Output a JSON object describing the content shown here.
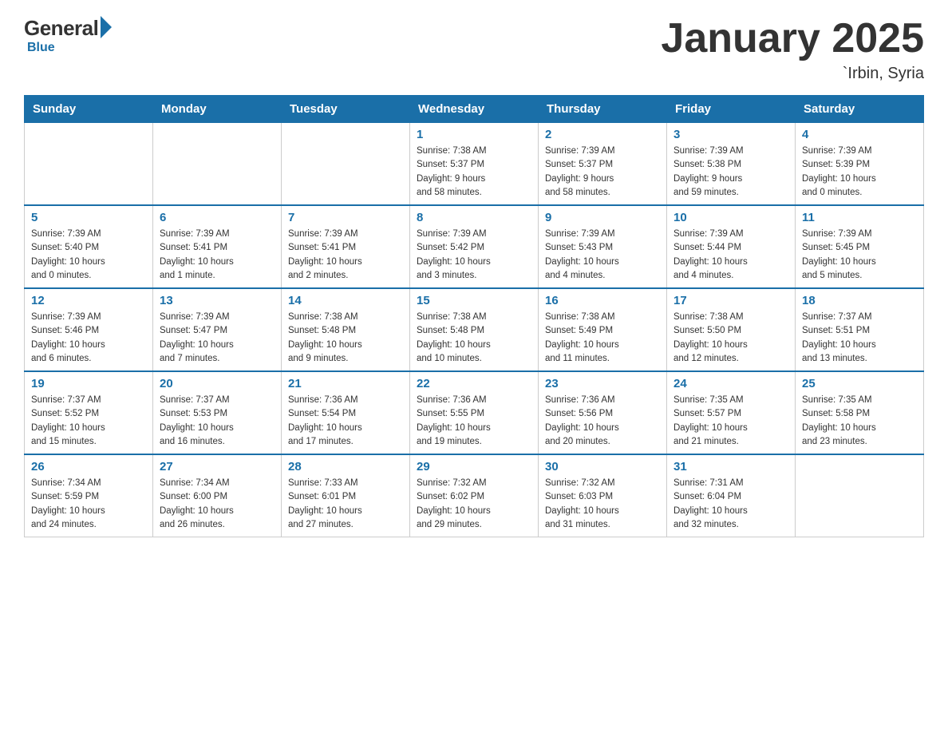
{
  "header": {
    "logo": {
      "general": "General",
      "blue": "Blue",
      "subtitle": "Blue"
    },
    "title": "January 2025",
    "location": "`Irbin, Syria"
  },
  "weekdays": [
    "Sunday",
    "Monday",
    "Tuesday",
    "Wednesday",
    "Thursday",
    "Friday",
    "Saturday"
  ],
  "weeks": [
    [
      {
        "day": "",
        "info": ""
      },
      {
        "day": "",
        "info": ""
      },
      {
        "day": "",
        "info": ""
      },
      {
        "day": "1",
        "info": "Sunrise: 7:38 AM\nSunset: 5:37 PM\nDaylight: 9 hours\nand 58 minutes."
      },
      {
        "day": "2",
        "info": "Sunrise: 7:39 AM\nSunset: 5:37 PM\nDaylight: 9 hours\nand 58 minutes."
      },
      {
        "day": "3",
        "info": "Sunrise: 7:39 AM\nSunset: 5:38 PM\nDaylight: 9 hours\nand 59 minutes."
      },
      {
        "day": "4",
        "info": "Sunrise: 7:39 AM\nSunset: 5:39 PM\nDaylight: 10 hours\nand 0 minutes."
      }
    ],
    [
      {
        "day": "5",
        "info": "Sunrise: 7:39 AM\nSunset: 5:40 PM\nDaylight: 10 hours\nand 0 minutes."
      },
      {
        "day": "6",
        "info": "Sunrise: 7:39 AM\nSunset: 5:41 PM\nDaylight: 10 hours\nand 1 minute."
      },
      {
        "day": "7",
        "info": "Sunrise: 7:39 AM\nSunset: 5:41 PM\nDaylight: 10 hours\nand 2 minutes."
      },
      {
        "day": "8",
        "info": "Sunrise: 7:39 AM\nSunset: 5:42 PM\nDaylight: 10 hours\nand 3 minutes."
      },
      {
        "day": "9",
        "info": "Sunrise: 7:39 AM\nSunset: 5:43 PM\nDaylight: 10 hours\nand 4 minutes."
      },
      {
        "day": "10",
        "info": "Sunrise: 7:39 AM\nSunset: 5:44 PM\nDaylight: 10 hours\nand 4 minutes."
      },
      {
        "day": "11",
        "info": "Sunrise: 7:39 AM\nSunset: 5:45 PM\nDaylight: 10 hours\nand 5 minutes."
      }
    ],
    [
      {
        "day": "12",
        "info": "Sunrise: 7:39 AM\nSunset: 5:46 PM\nDaylight: 10 hours\nand 6 minutes."
      },
      {
        "day": "13",
        "info": "Sunrise: 7:39 AM\nSunset: 5:47 PM\nDaylight: 10 hours\nand 7 minutes."
      },
      {
        "day": "14",
        "info": "Sunrise: 7:38 AM\nSunset: 5:48 PM\nDaylight: 10 hours\nand 9 minutes."
      },
      {
        "day": "15",
        "info": "Sunrise: 7:38 AM\nSunset: 5:48 PM\nDaylight: 10 hours\nand 10 minutes."
      },
      {
        "day": "16",
        "info": "Sunrise: 7:38 AM\nSunset: 5:49 PM\nDaylight: 10 hours\nand 11 minutes."
      },
      {
        "day": "17",
        "info": "Sunrise: 7:38 AM\nSunset: 5:50 PM\nDaylight: 10 hours\nand 12 minutes."
      },
      {
        "day": "18",
        "info": "Sunrise: 7:37 AM\nSunset: 5:51 PM\nDaylight: 10 hours\nand 13 minutes."
      }
    ],
    [
      {
        "day": "19",
        "info": "Sunrise: 7:37 AM\nSunset: 5:52 PM\nDaylight: 10 hours\nand 15 minutes."
      },
      {
        "day": "20",
        "info": "Sunrise: 7:37 AM\nSunset: 5:53 PM\nDaylight: 10 hours\nand 16 minutes."
      },
      {
        "day": "21",
        "info": "Sunrise: 7:36 AM\nSunset: 5:54 PM\nDaylight: 10 hours\nand 17 minutes."
      },
      {
        "day": "22",
        "info": "Sunrise: 7:36 AM\nSunset: 5:55 PM\nDaylight: 10 hours\nand 19 minutes."
      },
      {
        "day": "23",
        "info": "Sunrise: 7:36 AM\nSunset: 5:56 PM\nDaylight: 10 hours\nand 20 minutes."
      },
      {
        "day": "24",
        "info": "Sunrise: 7:35 AM\nSunset: 5:57 PM\nDaylight: 10 hours\nand 21 minutes."
      },
      {
        "day": "25",
        "info": "Sunrise: 7:35 AM\nSunset: 5:58 PM\nDaylight: 10 hours\nand 23 minutes."
      }
    ],
    [
      {
        "day": "26",
        "info": "Sunrise: 7:34 AM\nSunset: 5:59 PM\nDaylight: 10 hours\nand 24 minutes."
      },
      {
        "day": "27",
        "info": "Sunrise: 7:34 AM\nSunset: 6:00 PM\nDaylight: 10 hours\nand 26 minutes."
      },
      {
        "day": "28",
        "info": "Sunrise: 7:33 AM\nSunset: 6:01 PM\nDaylight: 10 hours\nand 27 minutes."
      },
      {
        "day": "29",
        "info": "Sunrise: 7:32 AM\nSunset: 6:02 PM\nDaylight: 10 hours\nand 29 minutes."
      },
      {
        "day": "30",
        "info": "Sunrise: 7:32 AM\nSunset: 6:03 PM\nDaylight: 10 hours\nand 31 minutes."
      },
      {
        "day": "31",
        "info": "Sunrise: 7:31 AM\nSunset: 6:04 PM\nDaylight: 10 hours\nand 32 minutes."
      },
      {
        "day": "",
        "info": ""
      }
    ]
  ]
}
